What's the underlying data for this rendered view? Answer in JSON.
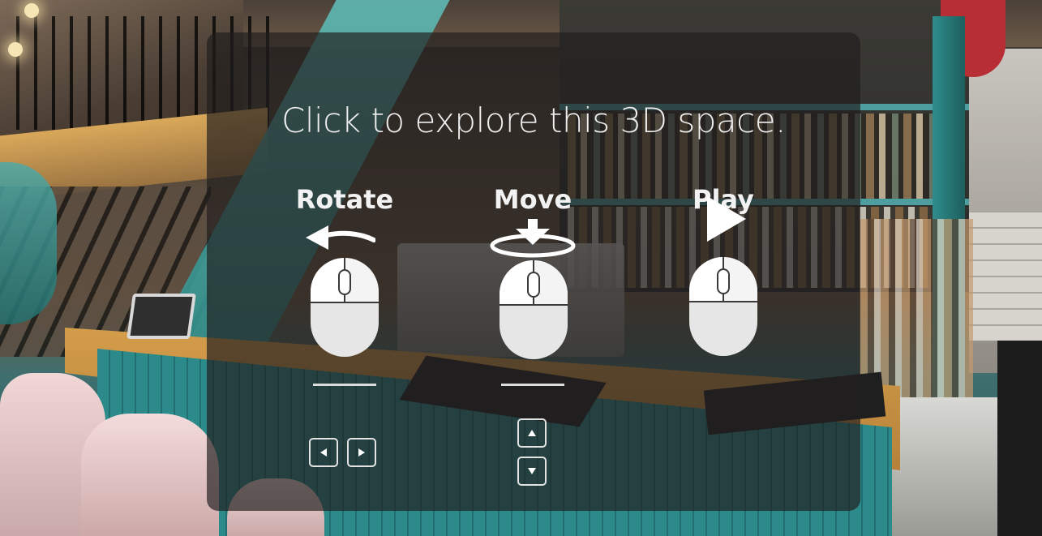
{
  "overlay": {
    "headline": "Click to explore this 3D space.",
    "controls": [
      {
        "label": "Rotate",
        "mouse_icon": "mouse-left-click-icon",
        "gesture_icon": "arrow-left-icon",
        "keys": [
          "arrow-left-key-icon",
          "arrow-right-key-icon"
        ]
      },
      {
        "label": "Move",
        "mouse_icon": "mouse-left-click-icon",
        "gesture_icon": "move-to-point-icon",
        "keys": [
          "arrow-up-key-icon",
          "arrow-down-key-icon"
        ]
      },
      {
        "label": "Play",
        "mouse_icon": "mouse-left-click-icon",
        "gesture_icon": "play-icon",
        "keys": []
      }
    ]
  },
  "colors": {
    "overlay_bg": "#201e1d",
    "text": "#f2f2f2",
    "accent_teal": "#2c8a8a"
  }
}
